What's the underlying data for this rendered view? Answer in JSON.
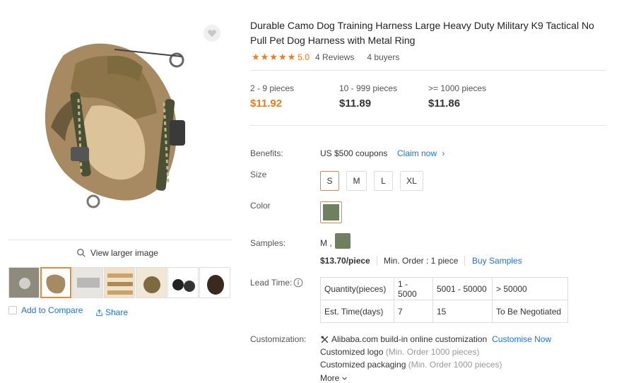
{
  "gallery": {
    "view_larger": "View larger image",
    "compare_label": "Add to Compare",
    "share_label": "Share",
    "thumbnails": [
      "thumb-1",
      "thumb-2",
      "thumb-3",
      "thumb-4",
      "thumb-5",
      "thumb-6",
      "thumb-7"
    ]
  },
  "product": {
    "title": "Durable Camo Dog Training Harness Large Heavy Duty Military K9 Tactical No Pull Pet Dog Harness with Metal Ring",
    "rating": "5.0",
    "reviews": "4 Reviews",
    "buyers": "4 buyers"
  },
  "prices": [
    {
      "range": "2 - 9 pieces",
      "price": "$11.92"
    },
    {
      "range": "10 - 999 pieces",
      "price": "$11.89"
    },
    {
      "range": ">= 1000 pieces",
      "price": "$11.86"
    }
  ],
  "benefits": {
    "label": "Benefits:",
    "text": "US $500 coupons",
    "claim": "Claim now"
  },
  "size": {
    "label": "Size",
    "options": [
      "S",
      "M",
      "L",
      "XL"
    ],
    "selected": "S"
  },
  "color": {
    "label": "Color",
    "swatch": "#6f8060"
  },
  "samples": {
    "label": "Samples:",
    "selection": "M ,",
    "price": "$13.70/piece",
    "min_order": "Min. Order : 1 piece",
    "buy": "Buy Samples"
  },
  "lead_time": {
    "label": "Lead Time:",
    "rows": [
      [
        "Quantity(pieces)",
        "1 - 5000",
        "5001 - 50000",
        "> 50000"
      ],
      [
        "Est. Time(days)",
        "7",
        "15",
        "To Be Negotiated"
      ]
    ]
  },
  "customization": {
    "label": "Customization:",
    "online": "Alibaba.com build-in online customization",
    "customise_now": "Customise Now",
    "logo": "Customized logo",
    "logo_min": "(Min. Order 1000 pieces)",
    "packaging": "Customized packaging",
    "packaging_min": "(Min. Order 1000 pieces)",
    "more": "More"
  },
  "colors": {
    "accent": "#f27a1a",
    "link": "#1a73e8",
    "selected_border": "#e6873f"
  }
}
